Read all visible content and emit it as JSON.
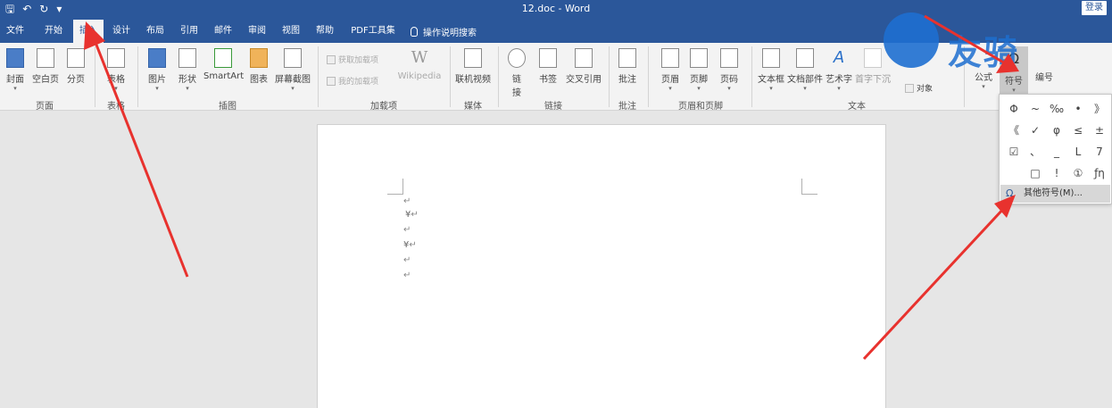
{
  "titlebar": {
    "title": "12.doc - Word",
    "login": "登录",
    "qat": [
      "save-icon",
      "undo-icon",
      "redo-icon",
      "customize-icon"
    ]
  },
  "tabs": [
    "文件",
    "开始",
    "插入",
    "设计",
    "布局",
    "引用",
    "邮件",
    "审阅",
    "视图",
    "帮助",
    "PDF工具集"
  ],
  "active_tab": "插入",
  "tell_me": "操作说明搜索",
  "ribbon": {
    "pages": {
      "cover": "封面",
      "blank": "空白页",
      "break": "分页",
      "label": "页面"
    },
    "tables": {
      "table": "表格",
      "label": "表格"
    },
    "illustrations": {
      "picture": "图片",
      "shapes": "形状",
      "smartart": "SmartArt",
      "chart": "图表",
      "screenshot": "屏幕截图",
      "label": "插图"
    },
    "addins": {
      "get": "获取加载项",
      "my": "我的加载项",
      "wiki": "Wikipedia",
      "label": "加载项"
    },
    "media": {
      "video": "联机视频",
      "label": "媒体"
    },
    "links": {
      "link_a": "链",
      "link_b": "接",
      "bookmark": "书签",
      "xref": "交叉引用",
      "label": "链接"
    },
    "comments": {
      "comment": "批注",
      "label": "批注"
    },
    "header_footer": {
      "header": "页眉",
      "footer": "页脚",
      "page_number": "页码",
      "label": "页眉和页脚"
    },
    "text": {
      "textbox": "文本框",
      "quickparts": "文档部件",
      "wordart": "艺术字",
      "dropcap": "首字下沉",
      "object": "对象",
      "label": "文本"
    },
    "symbols": {
      "equation": "公式",
      "symbol": "符号",
      "number": "编号"
    }
  },
  "document": {
    "para_mark": "↵",
    "yen": "¥"
  },
  "symbol_menu": {
    "symbols": [
      "Φ",
      "~",
      "‰",
      "•",
      "》",
      "《",
      "✓",
      "φ",
      "≤",
      "±",
      "☑",
      "、",
      "_",
      "L",
      "7",
      "",
      "□",
      "!",
      "①",
      "ƒη"
    ],
    "more": "其他符号(M)...",
    "more_icon": "omega-icon"
  },
  "watermark": {
    "text": "友骑"
  },
  "colors": {
    "accent": "#2b579a",
    "arrow": "#e8322e"
  }
}
